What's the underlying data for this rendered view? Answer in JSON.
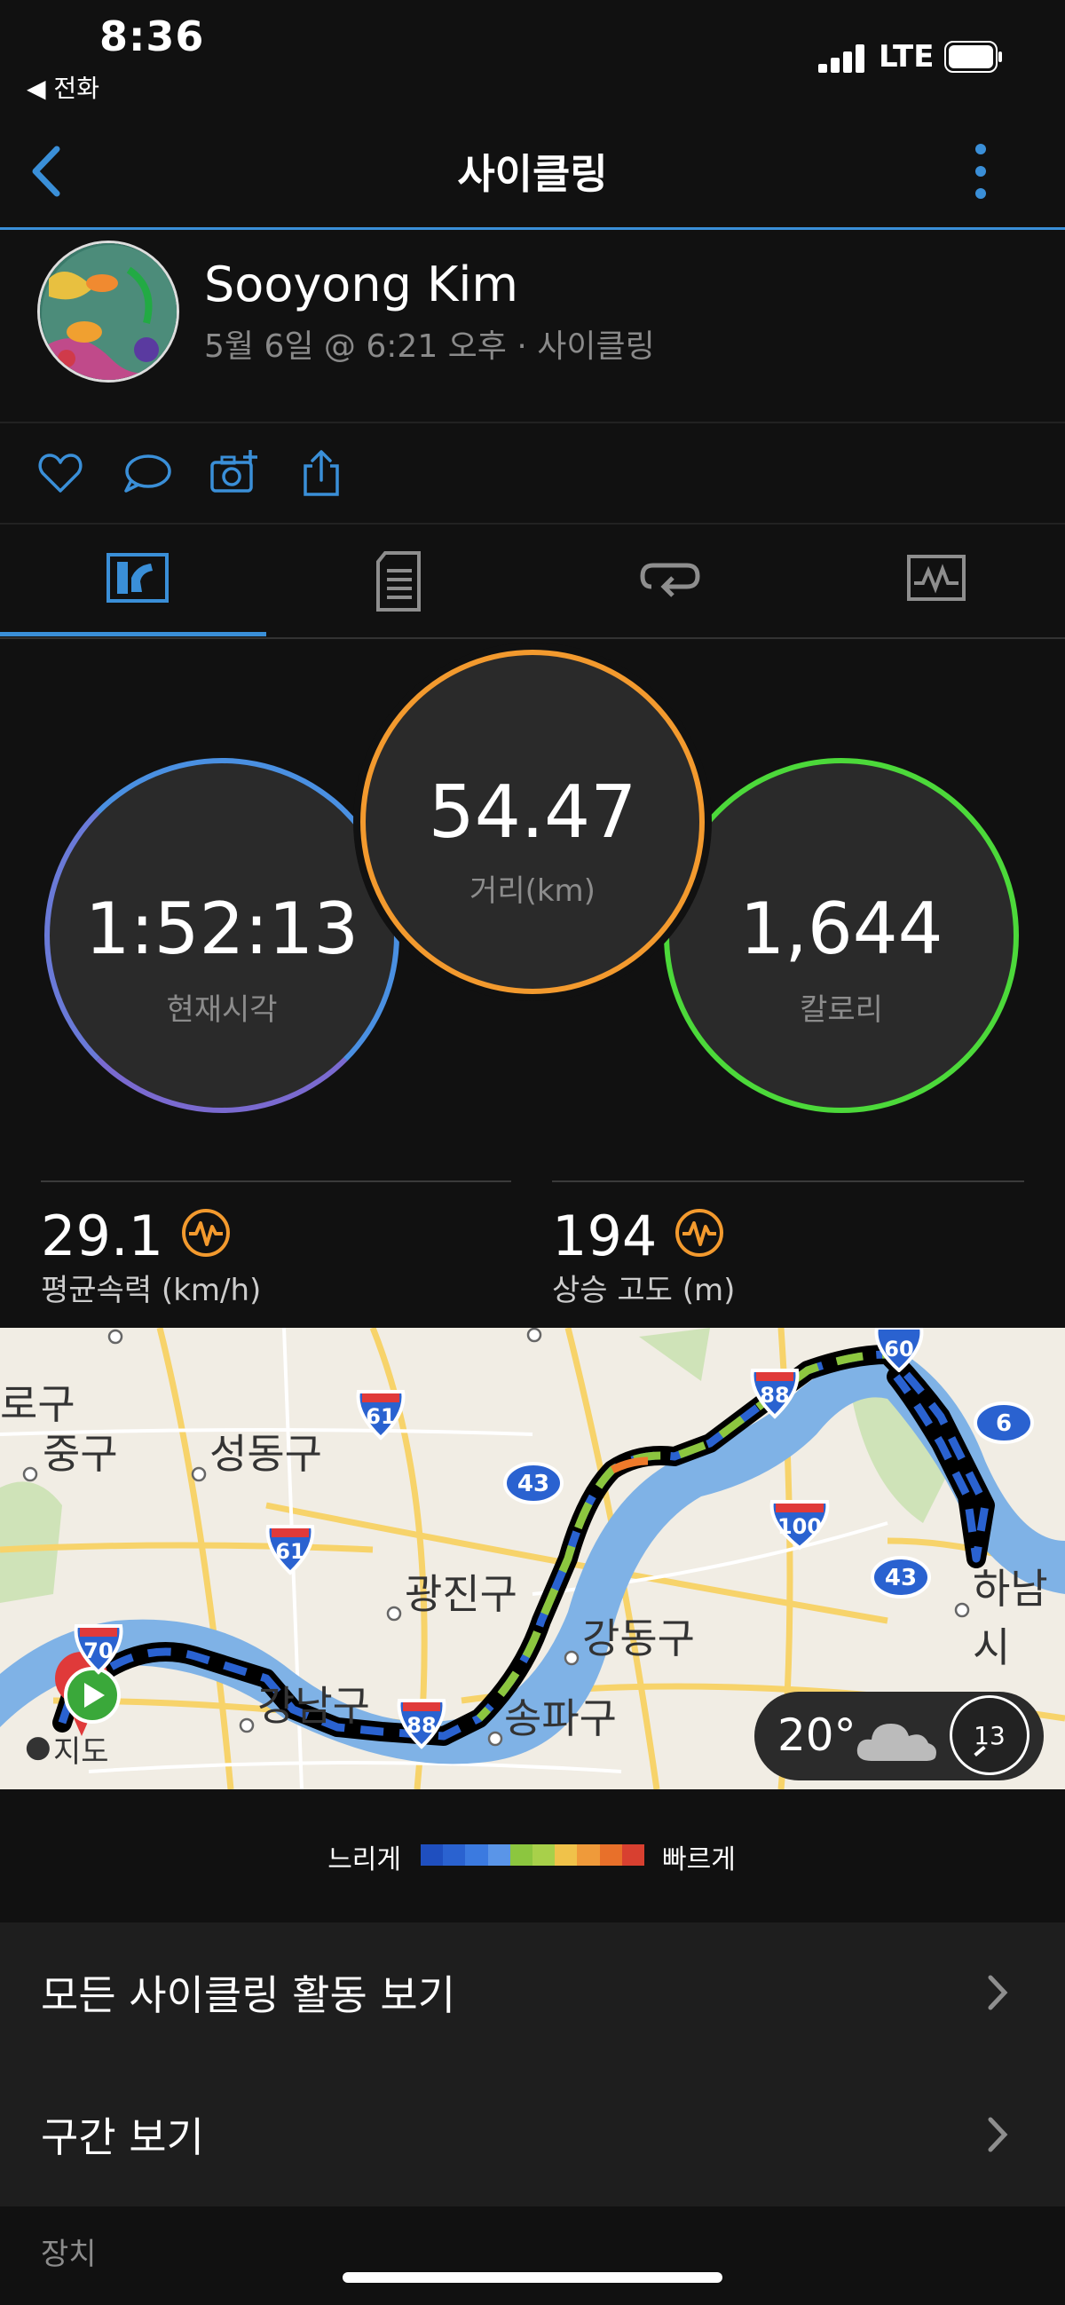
{
  "status_bar": {
    "time": "8:36",
    "back_app": "◀ 전화",
    "network": "LTE"
  },
  "nav": {
    "title": "사이클링"
  },
  "profile": {
    "name": "Sooyong Kim",
    "subtitle": "5월 6일 @ 6:21 오후 · 사이클링"
  },
  "actions": [
    "like-icon",
    "comment-icon",
    "add-photo-icon",
    "share-icon"
  ],
  "tabs": [
    "overview-tab-icon",
    "details-tab-icon",
    "laps-tab-icon",
    "charts-tab-icon"
  ],
  "stats": {
    "time": {
      "value": "1:52:13",
      "label": "현재시각"
    },
    "distance": {
      "value": "54.47",
      "label": "거리(km)"
    },
    "calories": {
      "value": "1,644",
      "label": "칼로리"
    },
    "avg_speed": {
      "value": "29.1",
      "label": "평균속력 (km/h)"
    },
    "ascent": {
      "value": "194",
      "label": "상승 고도 (m)"
    }
  },
  "map": {
    "labels": [
      "로구",
      "중구",
      "성동구",
      "광진구",
      "강동구",
      "강남구",
      "송파구",
      "하남시",
      "지도"
    ],
    "highways": [
      "61",
      "61",
      "43",
      "88",
      "60",
      "6",
      "100",
      "43",
      "70",
      "88"
    ],
    "weather": {
      "temp": "20°",
      "wind": "13"
    }
  },
  "legend": {
    "slow": "느리게",
    "fast": "빠르게",
    "colors": [
      "#1f4fbf",
      "#2a62d0",
      "#3b7ae0",
      "#5a95e8",
      "#8cc63f",
      "#a8d04a",
      "#f0c24a",
      "#ef9a3a",
      "#e8702a",
      "#d84030"
    ]
  },
  "list": {
    "all_activities": "모든 사이클링 활동 보기",
    "segments": "구간 보기",
    "device_header": "장치"
  },
  "colors": {
    "accent": "#3a8fd8",
    "time_ring": "#4a90e2",
    "distance_ring": "#f39a2e",
    "calories_ring": "#4cd93a"
  }
}
